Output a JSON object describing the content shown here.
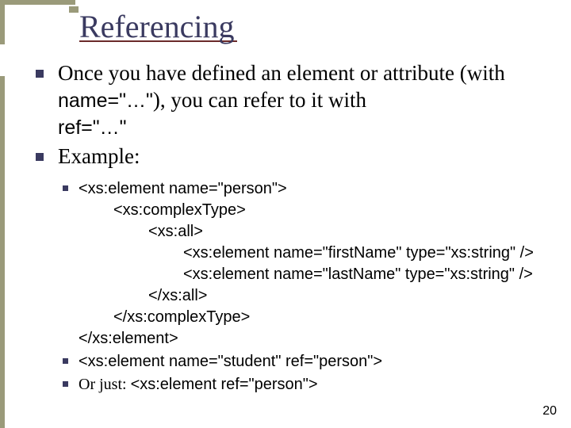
{
  "title": "Referencing",
  "bullets": {
    "b1_pre": "Once you have defined an element or attribute (with ",
    "b1_code1": "name=\"…\"",
    "b1_mid": "), you can refer to it with ",
    "b1_code2": "ref=\"…\"",
    "b2": "Example:"
  },
  "code": {
    "l1": "<xs:element   name=\"person\">",
    "l2": "<xs:complexType>",
    "l3": "<xs:all>",
    "l4": "<xs:element  name=\"firstName\"  type=\"xs:string\" />",
    "l5": "<xs:element  name=\"lastName\"   type=\"xs:string\" />",
    "l6": "</xs:all>",
    "l7": "</xs:complexType>",
    "l8": "</xs:element>",
    "s2": "<xs:element  name=\"student\"  ref=\"person\">",
    "s3_pre": "Or just: ",
    "s3_code": "<xs:element  ref=\"person\">"
  },
  "page": "20"
}
